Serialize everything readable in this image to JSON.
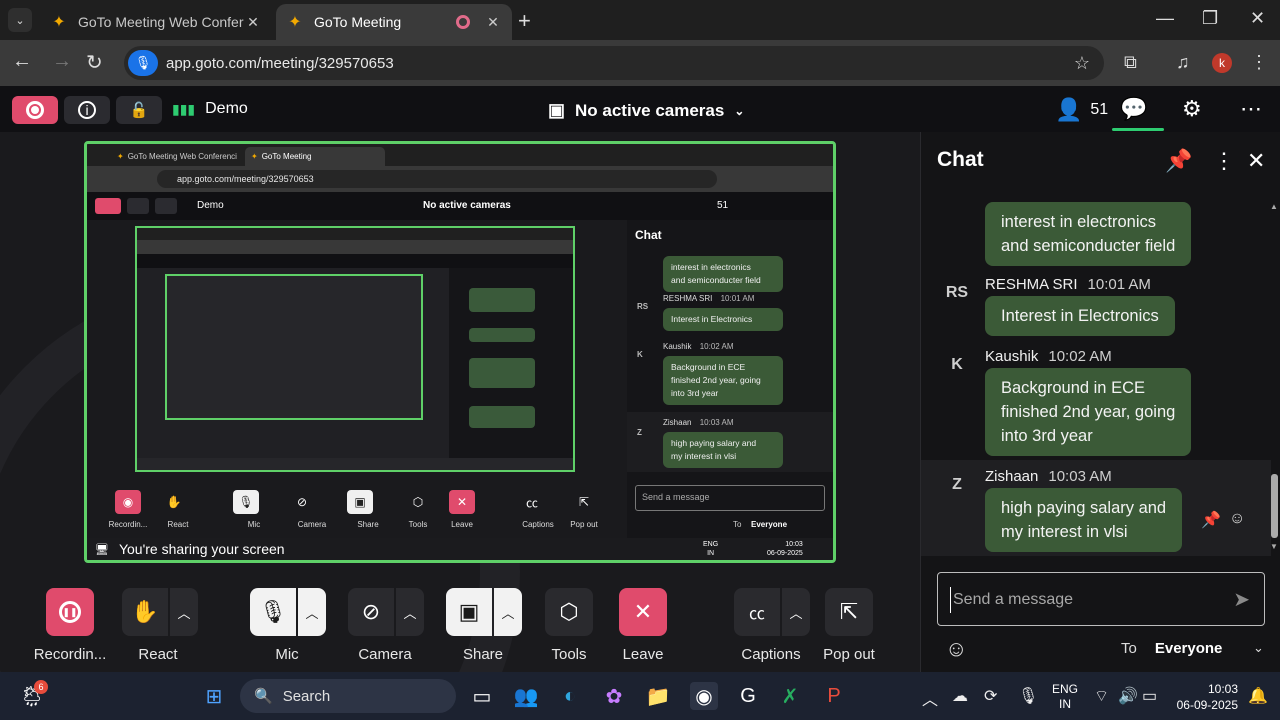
{
  "browser": {
    "tabs": [
      {
        "title": "GoTo Meeting Web Conferencin"
      },
      {
        "title": "GoTo Meeting"
      }
    ],
    "url": "app.goto.com/meeting/329570653",
    "profile_initial": "k"
  },
  "header": {
    "meeting_label": "Demo",
    "cameras_label": "No active cameras",
    "participant_count": "51"
  },
  "chat": {
    "title": "Chat",
    "messages": [
      {
        "text_line1": "interest in electronics",
        "text_line2": "and semiconducter field"
      },
      {
        "avatar": "RS",
        "author": "RESHMA SRI",
        "time": "10:01 AM",
        "text": "Interest in Electronics"
      },
      {
        "avatar": "K",
        "author": "Kaushik",
        "time": "10:02 AM",
        "text_line1": "Background in ECE",
        "text_line2": "finished 2nd year, going",
        "text_line3": "into 3rd year"
      },
      {
        "avatar": "Z",
        "author": "Zishaan",
        "time": "10:03 AM",
        "text_line1": "high paying salary and",
        "text_line2": "my interest in vlsi"
      }
    ],
    "input_placeholder": "Send a message",
    "to_label": "To",
    "to_value": "Everyone"
  },
  "toolbar": {
    "recording": "Recordin...",
    "react": "React",
    "mic": "Mic",
    "camera": "Camera",
    "share": "Share",
    "tools": "Tools",
    "leave": "Leave",
    "captions": "Captions",
    "pop_out": "Pop out"
  },
  "share_frame": {
    "sharing_text": "You're sharing your screen",
    "url": "app.goto.com/meeting/329570653",
    "meeting_label": "Demo",
    "cameras_label": "No active cameras",
    "participant_count": "51",
    "chat_title": "Chat",
    "tab1": "GoTo Meeting Web Conferenci",
    "tab2": "GoTo Meeting",
    "messages": [
      {
        "line1": "interest in electronics",
        "line2": "and semiconducter field"
      },
      {
        "avatar": "RS",
        "author": "RESHMA SRI",
        "time": "10:01 AM",
        "text": "Interest in Electronics"
      },
      {
        "avatar": "K",
        "author": "Kaushik",
        "time": "10:02 AM",
        "line1": "Background in ECE",
        "line2": "finished 2nd year, going",
        "line3": "into 3rd year"
      },
      {
        "avatar": "Z",
        "author": "Zishaan",
        "time": "10:03 AM",
        "line1": "high paying salary and",
        "line2": "my interest in vlsi"
      }
    ],
    "input_placeholder": "Send a message",
    "to_label": "To",
    "to_value": "Everyone",
    "lang": "ENG",
    "region": "IN",
    "time": "10:03",
    "date": "06-09-2025",
    "labels": {
      "recording": "Recordin...",
      "react": "React",
      "mic": "Mic",
      "camera": "Camera",
      "share": "Share",
      "tools": "Tools",
      "leave": "Leave",
      "captions": "Captions",
      "pop_out": "Pop out"
    }
  },
  "taskbar": {
    "search_placeholder": "Search",
    "weather_badge": "6",
    "lang": "ENG",
    "region": "IN",
    "time": "10:03",
    "date": "06-09-2025"
  },
  "colors": {
    "accent_green": "#5fd068",
    "bubble_green": "#3b5a37",
    "leave_red": "#e04b6c"
  }
}
